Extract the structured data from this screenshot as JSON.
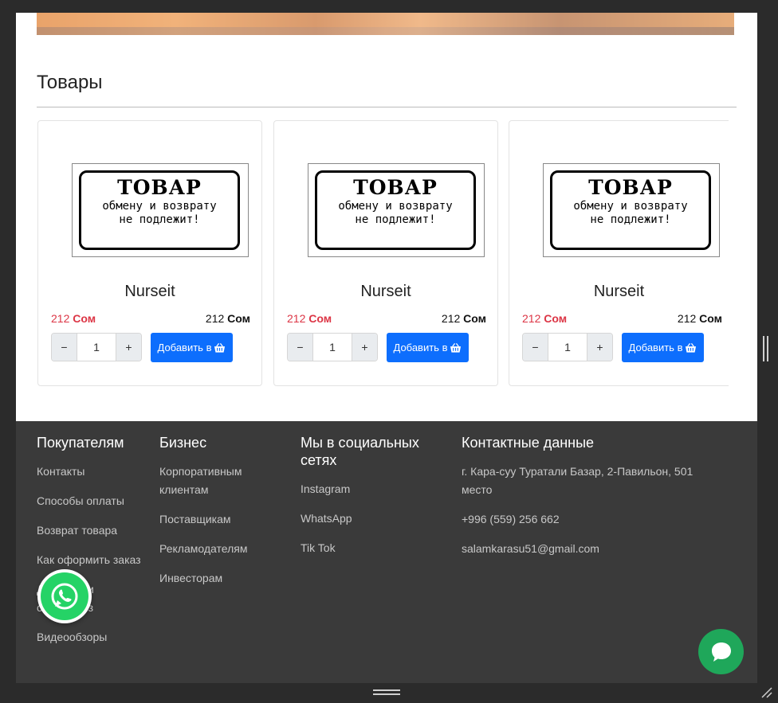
{
  "section": {
    "title": "Товары"
  },
  "products": [
    {
      "image_big": "ТОВАР",
      "image_line1": "обмену и возврату",
      "image_line2": "не подлежит!",
      "name": "Nurseit",
      "old_price": "212",
      "new_price": "212",
      "currency": "Сом",
      "qty": "1",
      "minus": "−",
      "plus": "+",
      "add_label": "Добавить в"
    },
    {
      "image_big": "ТОВАР",
      "image_line1": "обмену и возврату",
      "image_line2": "не подлежит!",
      "name": "Nurseit",
      "old_price": "212",
      "new_price": "212",
      "currency": "Сом",
      "qty": "1",
      "minus": "−",
      "plus": "+",
      "add_label": "Добавить в"
    },
    {
      "image_big": "ТОВАР",
      "image_line1": "обмену и возврату",
      "image_line2": "не подлежит!",
      "name": "Nurseit",
      "old_price": "212",
      "new_price": "212",
      "currency": "Сом",
      "qty": "1",
      "minus": "−",
      "plus": "+",
      "add_label": "Добавить в"
    }
  ],
  "footer": {
    "buyers": {
      "title": "Покупателям",
      "links": [
        "Контакты",
        "Способы оплаты",
        "Возврат товара",
        "Как оформить заказ",
        "Доставка и самовывоз",
        "Видеообзоры"
      ]
    },
    "business": {
      "title": "Бизнес",
      "links": [
        "Корпоративным клиентам",
        "Поставщикам",
        "Рекламодателям",
        "Инвесторам"
      ]
    },
    "social": {
      "title": "Мы в социальных сетях",
      "links": [
        "Instagram",
        "WhatsApp",
        "Tik Tok"
      ]
    },
    "contacts": {
      "title": "Контактные данные",
      "address": "г. Кара-суу Туратали Базар, 2-Павильон, 501 место",
      "phone": "+996 (559) 256 662",
      "email": "salamkarasu51@gmail.com"
    }
  },
  "icons": {
    "basket": "basket-icon",
    "whatsapp": "whatsapp-icon",
    "chat": "chat-icon"
  },
  "colors": {
    "accent": "#0d6efd",
    "old_price": "#dc3545",
    "footer_bg": "#3a3a3a",
    "whatsapp": "#25d366",
    "chat": "#1fa75a"
  }
}
